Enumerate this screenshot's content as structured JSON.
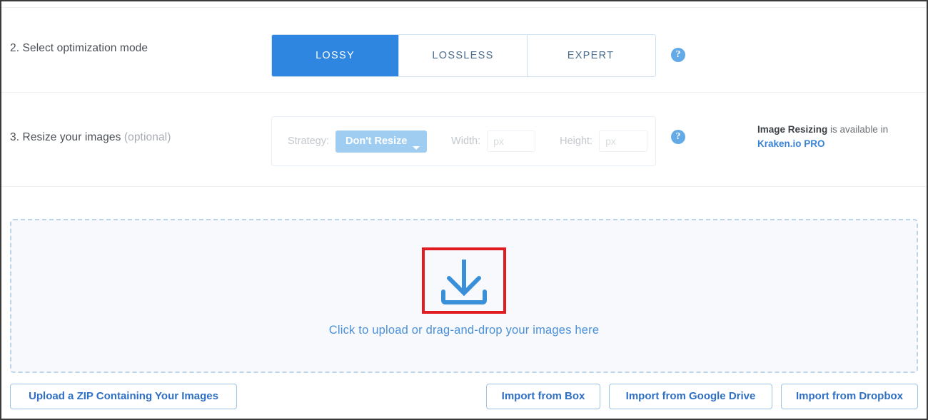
{
  "sections": {
    "mode": {
      "step_label_number": "2. ",
      "step_label": "2. Select optimization mode",
      "tabs": [
        {
          "label": "LOSSY",
          "active": true
        },
        {
          "label": "LOSSLESS",
          "active": false
        },
        {
          "label": "EXPERT",
          "active": false
        }
      ],
      "help_icon": "?",
      "help_icon_name": "question-mark-icon"
    },
    "resize": {
      "step_label_main": "3. Resize your images",
      "step_label_optional": " (optional)",
      "strategy_label": "Strategy:",
      "strategy_value": "Don't Resize",
      "width_label": "Width:",
      "width_value": "",
      "width_placeholder": "px",
      "height_label": "Height:",
      "height_value": "",
      "height_placeholder": "px",
      "help_icon": "?",
      "pro_note_bold": "Image Resizing",
      "pro_note_rest": " is available in",
      "pro_note_link": "Kraken.io PRO"
    },
    "dropzone": {
      "text": "Click to upload or drag-and-drop your images here",
      "icon_name": "download-arrow-icon"
    },
    "footer": {
      "buttons": [
        {
          "label": "Upload a ZIP Containing Your Images",
          "name": "upload-zip-button"
        },
        {
          "label": "Import from Box",
          "name": "import-from-box-button"
        },
        {
          "label": "Import from Google Drive",
          "name": "import-from-google-drive-button"
        },
        {
          "label": "Import from Dropbox",
          "name": "import-from-dropbox-button"
        }
      ]
    }
  },
  "annotation": {
    "color": "#e01b22",
    "target": "upload-icon"
  },
  "colors": {
    "accent_blue": "#2e86e0",
    "link_blue": "#3b83d4",
    "tab_border": "#cfe0f0",
    "dropzone_bg": "#f8f9fc",
    "dropzone_border": "#bcd4e8",
    "help_icon_bg": "#64aae6",
    "strategy_btn_bg": "#9fcdf1",
    "annotation_red": "#e01b22"
  }
}
